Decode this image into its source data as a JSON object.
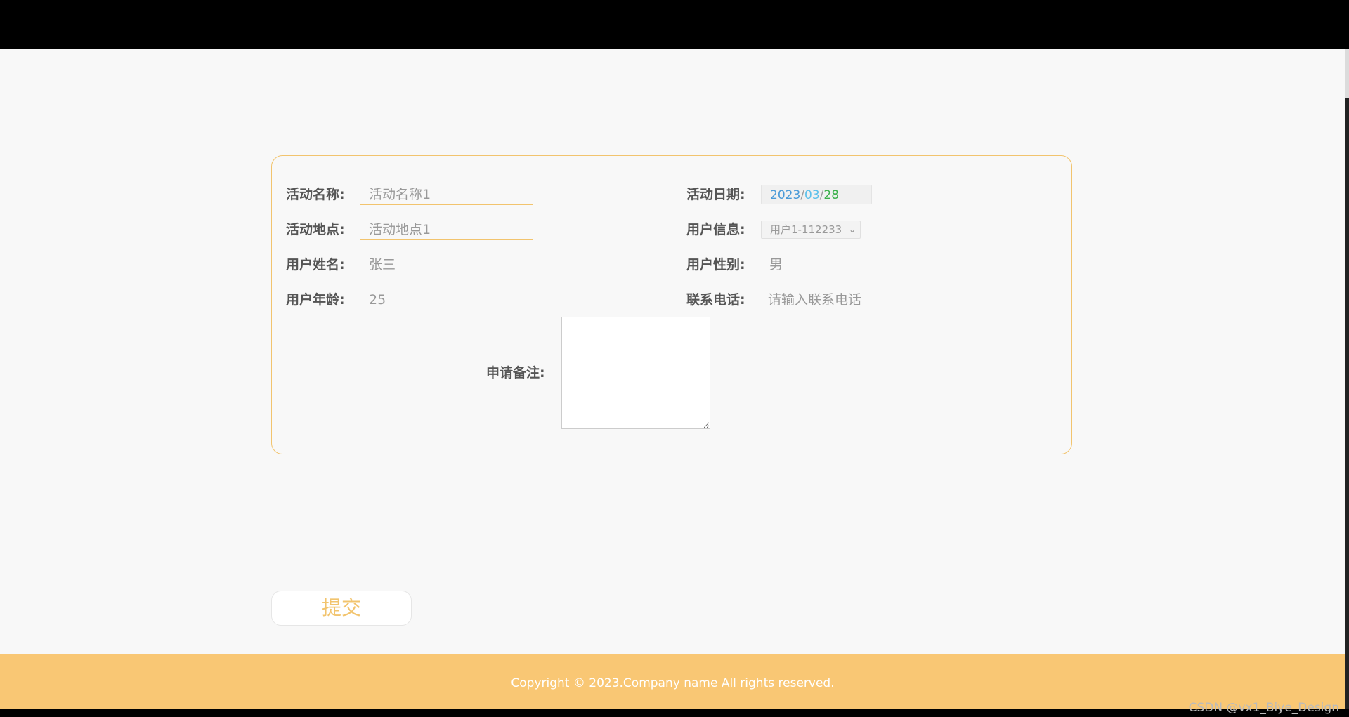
{
  "form": {
    "activity_name": {
      "label": "活动名称:",
      "value": "活动名称1"
    },
    "activity_date": {
      "label": "活动日期:",
      "year": "2023",
      "month": "03",
      "day": "28",
      "sep": "/"
    },
    "activity_location": {
      "label": "活动地点:",
      "value": "活动地点1"
    },
    "user_info": {
      "label": "用户信息:",
      "selected": "用户1-112233"
    },
    "user_name": {
      "label": "用户姓名:",
      "value": "张三"
    },
    "user_gender": {
      "label": "用户性别:",
      "value": "男"
    },
    "user_age": {
      "label": "用户年龄:",
      "value": "25"
    },
    "contact_phone": {
      "label": "联系电话:",
      "placeholder": "请输入联系电话"
    },
    "remarks": {
      "label": "申请备注:"
    }
  },
  "submit_label": "提交",
  "footer": {
    "copyright": "Copyright © 2023.Company name All rights reserved."
  },
  "watermark": "CSDN @vx1_Biye_Design",
  "colors": {
    "accent": "#f2c46e",
    "footer_bg": "#f9c774"
  }
}
